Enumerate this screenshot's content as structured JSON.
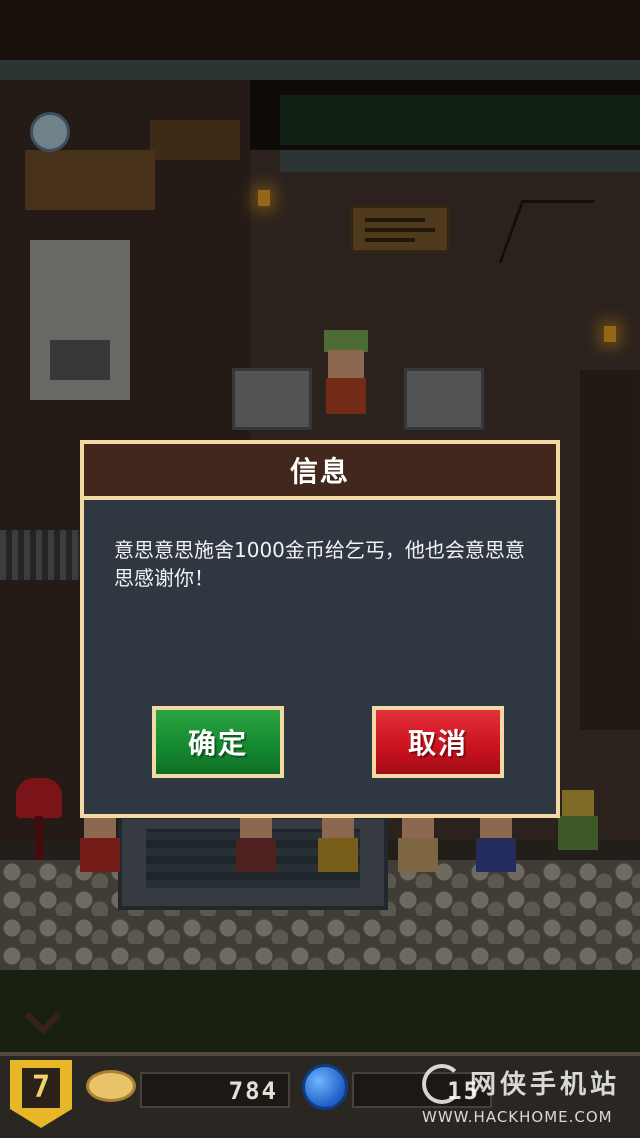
{
  "dialog": {
    "title": "信息",
    "message": "意思意思施舍1000金币给乞丐，他也会意思意思感谢你！",
    "confirm_label": "确定",
    "cancel_label": "取消"
  },
  "hud": {
    "level": "7",
    "gold": "784",
    "gems": "15"
  },
  "watermark": {
    "cn": "网侠手机站",
    "en": "WWW.HACKHOME.COM"
  },
  "colors": {
    "dialog_border": "#f3d9a4",
    "dialog_header": "#42281c",
    "dialog_body": "#2f3740",
    "confirm": "#15882f",
    "cancel": "#c8121e"
  },
  "icons": [
    "level-badge-icon",
    "gold-coin-icon",
    "blue-gem-icon",
    "mailbox-icon",
    "down-arrow-icon",
    "hackhome-logo-icon"
  ]
}
